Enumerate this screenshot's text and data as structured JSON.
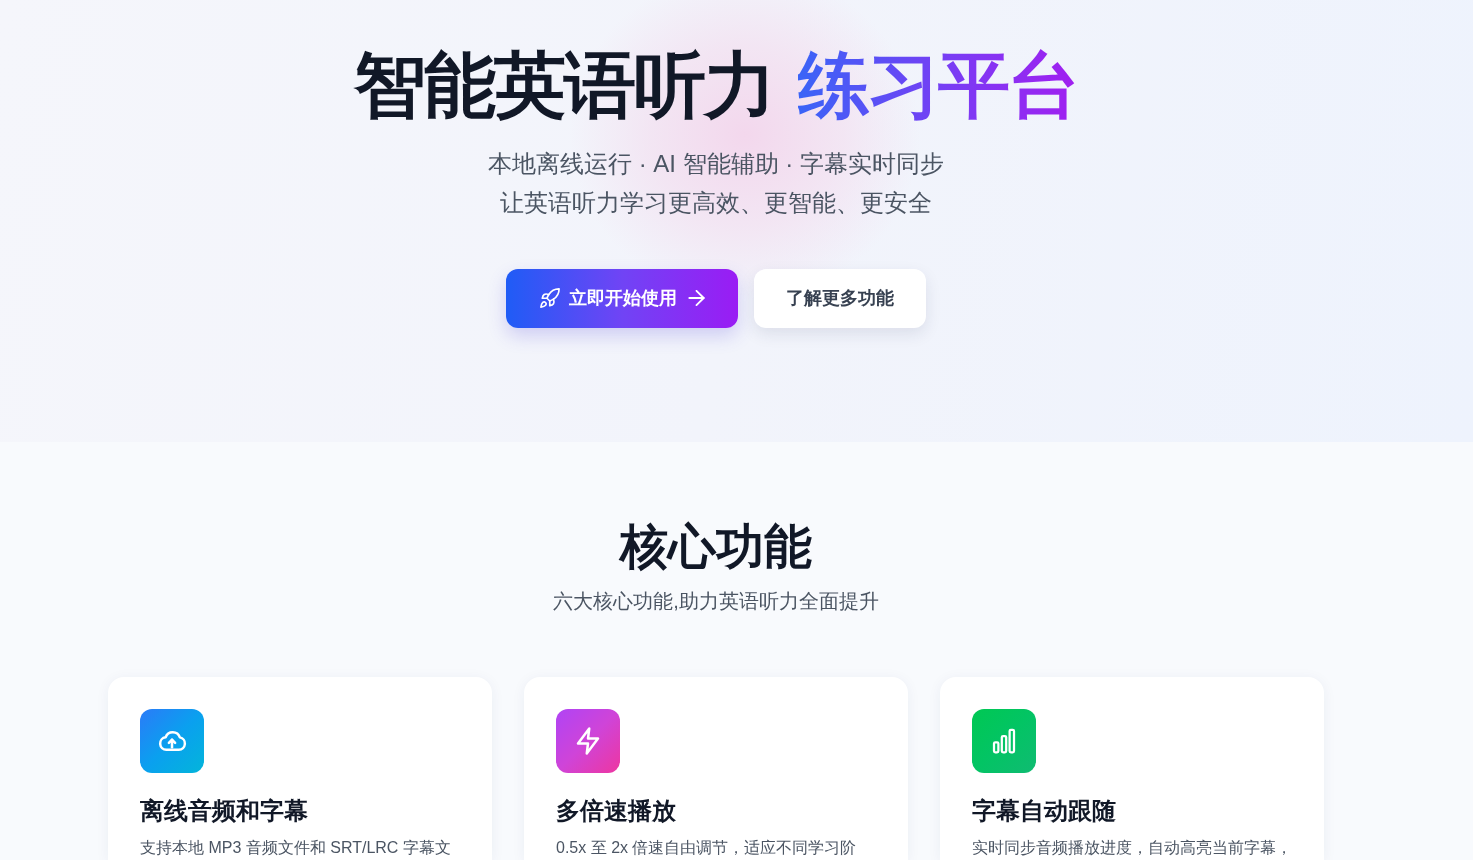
{
  "hero": {
    "title": {
      "text": "智能英语听力",
      "highlight": "练习平台"
    },
    "tagline": [
      "本地离线运行 · AI 智能辅助 · 字幕实时同步",
      "让英语听力学习更高效、更智能、更安全"
    ],
    "buttons": [
      {
        "label": "立即开始使用",
        "kind": "primary"
      },
      {
        "label": "了解更多功能",
        "kind": "secondary"
      }
    ]
  },
  "features_section": {
    "title": "核心功能",
    "subtitle": "六大核心功能,助力英语听力全面提升",
    "features": [
      {
        "kind": "upload",
        "title": "离线音频和字幕",
        "description": "支持本地 MP3 音频文件和 SRT/LRC 字幕文"
      },
      {
        "kind": "speed",
        "title": "多倍速播放",
        "description": "0.5x 至 2x 倍速自由调节，适应不同学习阶"
      },
      {
        "kind": "sync",
        "title": "字幕自动跟随",
        "description": "实时同步音频播放进度，自动高亮当前字幕，"
      }
    ]
  }
}
